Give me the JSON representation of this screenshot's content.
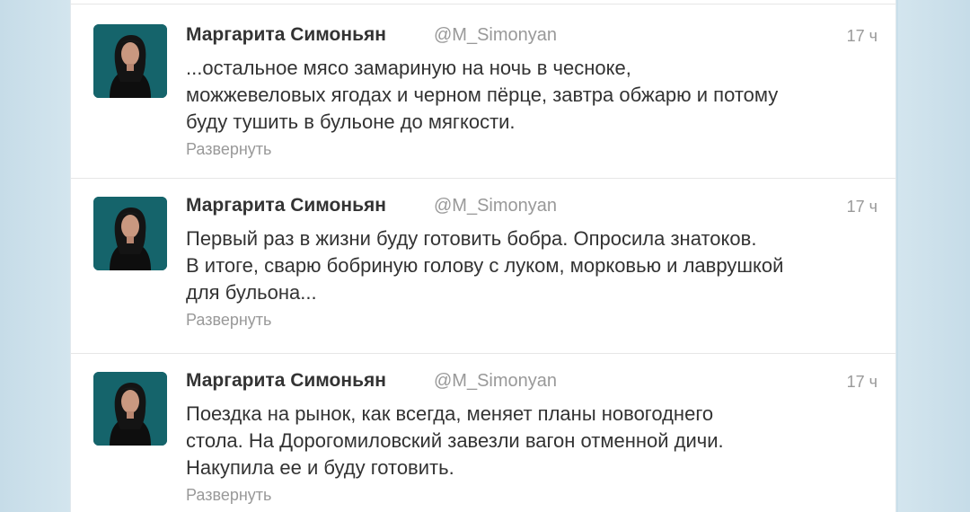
{
  "colors": {
    "page_background": "#c9dfea",
    "card_background": "#ffffff",
    "name_text": "#333333",
    "muted_text": "#999999",
    "avatar_teal": "#1b6b73"
  },
  "tweets": [
    {
      "fullname": "Маргарита Симоньян",
      "username": "@M_Simonyan",
      "timestamp": "17 ч",
      "text": "...остальное мясо замариную на ночь в чесноке,\nможжевеловых ягодах и черном пёрце, завтра обжарю и потому\nбуду тушить в бульоне до мягкости.",
      "expand_label": "Развернуть",
      "avatar_icon": "profile-photo-icon"
    },
    {
      "fullname": "Маргарита Симоньян",
      "username": "@M_Simonyan",
      "timestamp": "17 ч",
      "text": "Первый раз в жизни буду готовить бобра. Опросила знатоков.\nВ итоге, сварю бобриную голову с луком, морковью и лаврушкой\nдля бульона...",
      "expand_label": "Развернуть",
      "avatar_icon": "profile-photo-icon"
    },
    {
      "fullname": "Маргарита Симоньян",
      "username": "@M_Simonyan",
      "timestamp": "17 ч",
      "text": "Поездка на рынок, как всегда, меняет планы новогоднего\nстола. На Дорогомиловский завезли вагон отменной дичи.\nНакупила ее и буду готовить.",
      "expand_label": "Развернуть",
      "avatar_icon": "profile-photo-icon"
    }
  ]
}
